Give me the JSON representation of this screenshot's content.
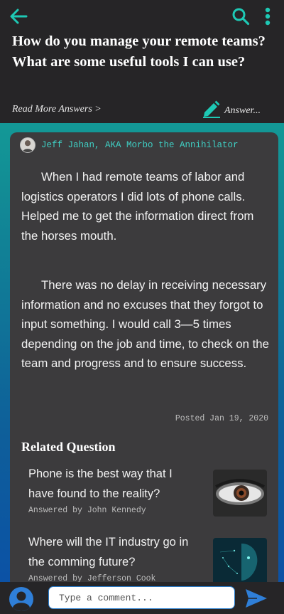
{
  "header": {
    "question_title": "How do you manage your remote teams? What are some useful tools I can use?",
    "read_more_label": "Read More Answers >",
    "answer_label": "Answer..."
  },
  "answer": {
    "author": "Jeff Jahan, AKA Morbo the Annihilator",
    "paragraphs": [
      "When I had remote teams of labor and logistics operators I did lots of phone calls. Helped me to get the information direct from the horses mouth.",
      "There was no delay in receiving necessary information and no excuses that they forgot to input something. I would call 3—5 times depending on the job and  time, to check on the team and progress and to ensure success."
    ],
    "posted": "Posted Jan 19, 2020"
  },
  "related": {
    "title": "Related Question",
    "items": [
      {
        "question": "Phone is the best way that I have found to the reality?",
        "answered_by": "Answered by John Kennedy",
        "thumb_icon": "eye-image"
      },
      {
        "question": "Where will the IT industry go in the comming future?",
        "answered_by": "Answered by Jefferson Cook",
        "thumb_icon": "digital-face-image"
      }
    ]
  },
  "comment": {
    "placeholder": "Type a comment..."
  },
  "colors": {
    "accent": "#1ec9b5",
    "header_bg": "#262527",
    "card_bg": "#3c3b3d",
    "author": "#3fd0c5",
    "send": "#2f7fd8"
  }
}
